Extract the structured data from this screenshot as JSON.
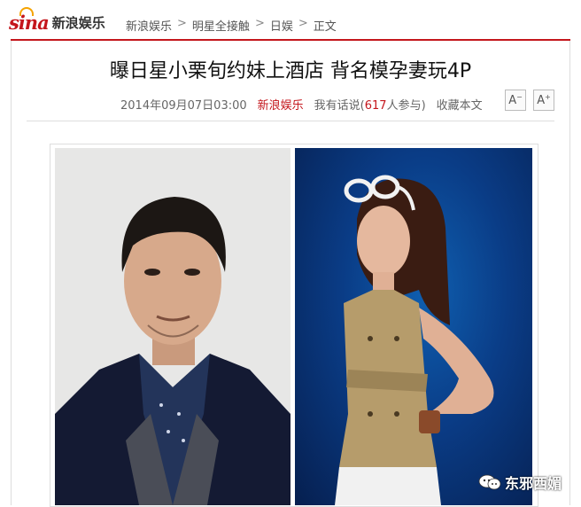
{
  "header": {
    "logo_text": "sina",
    "site_name": "新浪娱乐",
    "breadcrumb": [
      "新浪娱乐",
      "明星全接触",
      "日娱",
      "正文"
    ],
    "separator": ">",
    "accent_color": "#c4161c"
  },
  "article": {
    "title": "曝日星小栗旬约妹上酒店 背名模孕妻玩4P",
    "date": "2014年09月07日03:00",
    "source": "新浪娱乐",
    "comment_prefix": "我有话说(",
    "comment_count": "617",
    "comment_suffix": "人参与)",
    "favorite": "收藏本文",
    "font_decrease": "A",
    "font_increase": "A"
  },
  "watermark": {
    "text": "东邪西媚",
    "icon": "wechat-icon"
  }
}
